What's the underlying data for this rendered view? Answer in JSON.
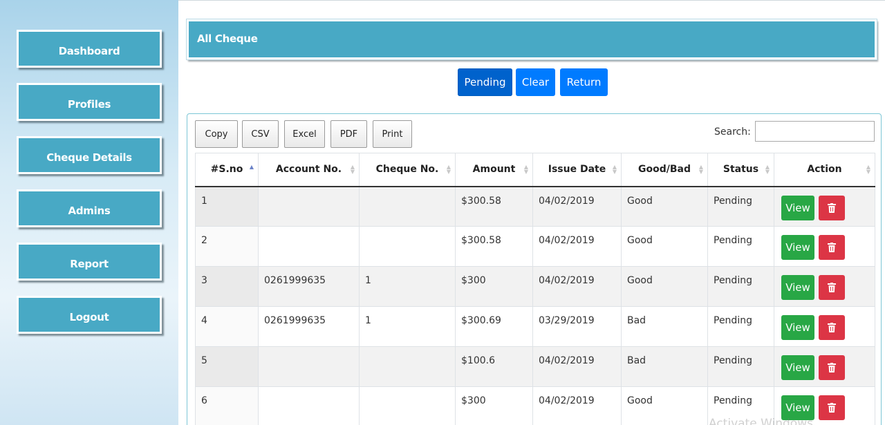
{
  "sidebar": {
    "items": [
      {
        "label": "Dashboard"
      },
      {
        "label": "Profiles"
      },
      {
        "label": "Cheque Details"
      },
      {
        "label": "Admins"
      },
      {
        "label": "Report"
      },
      {
        "label": "Logout"
      }
    ]
  },
  "header": {
    "title": "All Cheque"
  },
  "filters": {
    "pending": "Pending",
    "clear": "Clear",
    "return": "Return"
  },
  "export": {
    "copy": "Copy",
    "csv": "CSV",
    "excel": "Excel",
    "pdf": "PDF",
    "print": "Print"
  },
  "search": {
    "label": "Search:",
    "value": ""
  },
  "table": {
    "columns": [
      "#S.no",
      "Account No.",
      "Cheque No.",
      "Amount",
      "Issue Date",
      "Good/Bad",
      "Status",
      "Action"
    ],
    "rows": [
      {
        "sno": "1",
        "account": "",
        "cheque": "",
        "amount": "$300.58",
        "date": "04/02/2019",
        "quality": "Good",
        "status": "Pending"
      },
      {
        "sno": "2",
        "account": "",
        "cheque": "",
        "amount": "$300.58",
        "date": "04/02/2019",
        "quality": "Good",
        "status": "Pending"
      },
      {
        "sno": "3",
        "account": "0261999635",
        "cheque": "1",
        "amount": "$300",
        "date": "04/02/2019",
        "quality": "Good",
        "status": "Pending"
      },
      {
        "sno": "4",
        "account": "0261999635",
        "cheque": "1",
        "amount": "$300.69",
        "date": "03/29/2019",
        "quality": "Bad",
        "status": "Pending"
      },
      {
        "sno": "5",
        "account": "",
        "cheque": "",
        "amount": "$100.6",
        "date": "04/02/2019",
        "quality": "Bad",
        "status": "Pending"
      },
      {
        "sno": "6",
        "account": "",
        "cheque": "",
        "amount": "$300",
        "date": "04/02/2019",
        "quality": "Good",
        "status": "Pending"
      }
    ],
    "view_label": "View"
  },
  "watermark": "Activate Windows",
  "colors": {
    "accent": "#48a9c5",
    "primary": "#007bff",
    "success": "#28a745",
    "danger": "#dc3545",
    "warning": "#ffa726"
  }
}
